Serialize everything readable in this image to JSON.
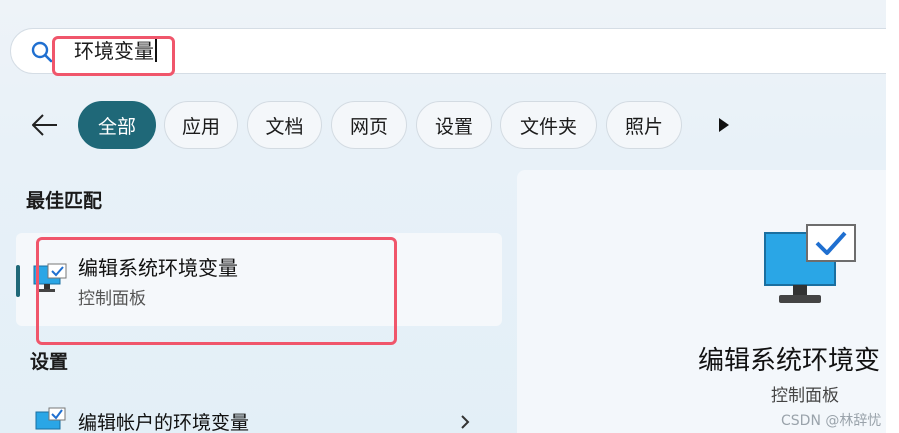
{
  "search": {
    "value": "环境变量"
  },
  "filters": {
    "back_icon": "arrow-left-icon",
    "tabs": [
      {
        "label": "全部",
        "active": true
      },
      {
        "label": "应用"
      },
      {
        "label": "文档"
      },
      {
        "label": "网页"
      },
      {
        "label": "设置"
      },
      {
        "label": "文件夹"
      },
      {
        "label": "照片"
      }
    ],
    "more_icon": "play-right-icon"
  },
  "best_match": {
    "section_title": "最佳匹配",
    "title": "编辑系统环境变量",
    "subtitle": "控制面板"
  },
  "settings": {
    "section_title": "设置",
    "items": [
      {
        "label": "编辑帐户的环境变量"
      }
    ]
  },
  "detail": {
    "title": "编辑系统环境变",
    "subtitle": "控制面板"
  },
  "watermark": "CSDN @林辞忧",
  "colors": {
    "accent": "#1f6878",
    "highlight": "#f0566b",
    "icon_blue": "#2aa6e6"
  }
}
